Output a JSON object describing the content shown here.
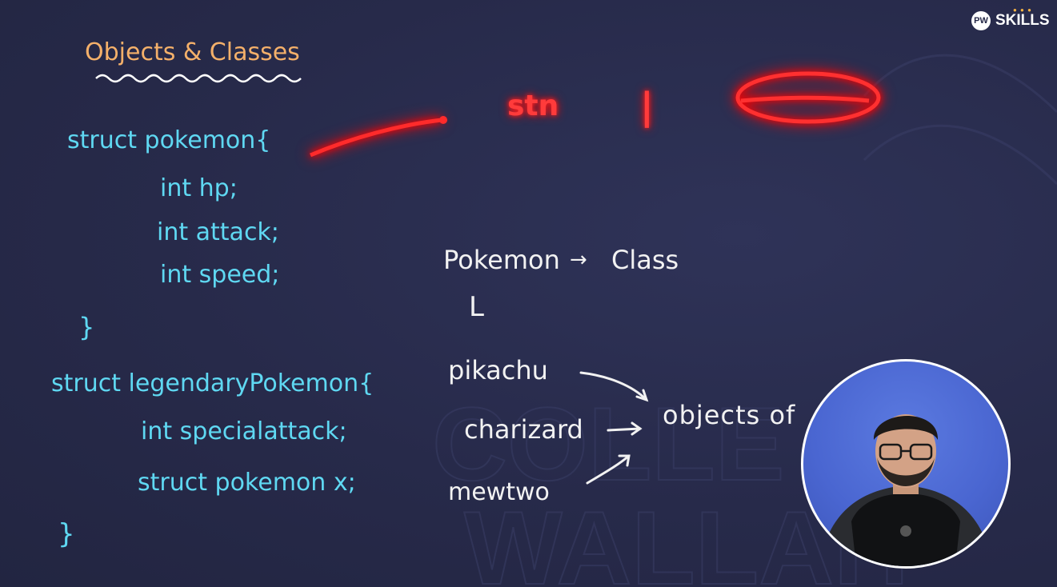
{
  "logo": {
    "badge": "PW",
    "text": "SKILLS"
  },
  "heading": "Objects & Classes",
  "code_block_1": {
    "line1": "struct pokemon{",
    "line2": "int hp;",
    "line3": "int attack;",
    "line4": "int speed;",
    "close": "}"
  },
  "code_block_2": {
    "line1": "struct legendaryPokemon{",
    "line2": "int specialattack;",
    "line3": "struct pokemon x;",
    "close": "}"
  },
  "annotation": {
    "red_text": "stn",
    "red_mark": "|"
  },
  "diagram": {
    "class_name": "Pokemon",
    "arrow": "→",
    "class_label": "Class",
    "branch": "L",
    "item1": "pikachu",
    "item2": "charizard",
    "item3": "mewtwo",
    "objects_label": "objects of"
  },
  "colors": {
    "background": "#272a4a",
    "heading": "#f4b06a",
    "code": "#5fd8f2",
    "diagram": "#f2f2f2",
    "highlight": "#ff3b3b"
  }
}
